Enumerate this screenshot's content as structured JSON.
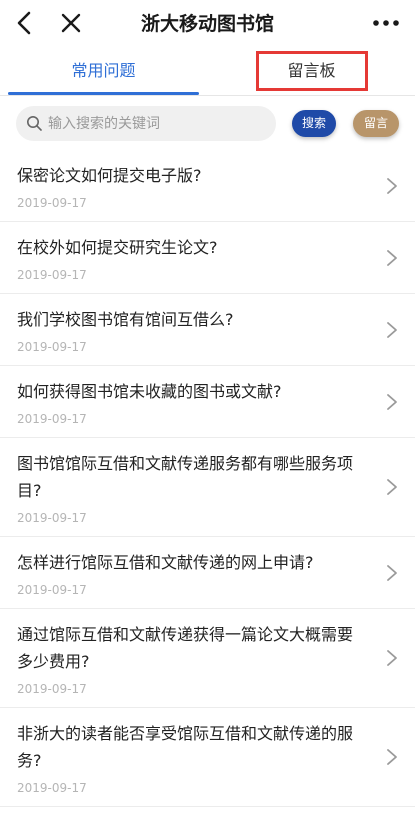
{
  "header": {
    "title": "浙大移动图书馆",
    "back_icon": "back-arrow-icon",
    "close_icon": "close-icon",
    "more_icon": "more-icon"
  },
  "tabs": [
    {
      "label": "常用问题",
      "active": true
    },
    {
      "label": "留言板",
      "active": false,
      "highlighted": true
    }
  ],
  "search": {
    "placeholder": "输入搜索的关键词",
    "value": "",
    "button_label": "搜索",
    "message_button_label": "留言"
  },
  "colors": {
    "accent": "#2f6fd6",
    "search_button": "#1f4aa8",
    "message_button": "#b8956a",
    "highlight_box": "#e53935"
  },
  "faqs": [
    {
      "question": "保密论文如何提交电子版?",
      "date": "2019-09-17"
    },
    {
      "question": "在校外如何提交研究生论文?",
      "date": "2019-09-17"
    },
    {
      "question": "我们学校图书馆有馆间互借么?",
      "date": "2019-09-17"
    },
    {
      "question": "如何获得图书馆未收藏的图书或文献?",
      "date": "2019-09-17"
    },
    {
      "question": "图书馆馆际互借和文献传递服务都有哪些服务项目?",
      "date": "2019-09-17"
    },
    {
      "question": "怎样进行馆际互借和文献传递的网上申请?",
      "date": "2019-09-17"
    },
    {
      "question": "通过馆际互借和文献传递获得一篇论文大概需要多少费用?",
      "date": "2019-09-17"
    },
    {
      "question": "非浙大的读者能否享受馆际互借和文献传递的服务?",
      "date": "2019-09-17"
    }
  ]
}
